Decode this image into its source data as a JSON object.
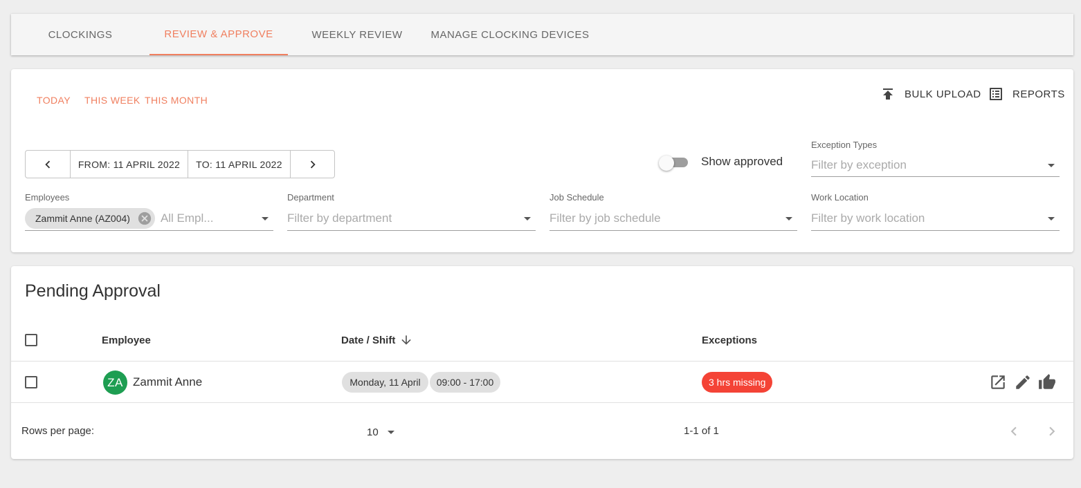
{
  "tabs": [
    {
      "label": "CLOCKINGS",
      "active": false
    },
    {
      "label": "REVIEW & APPROVE",
      "active": true
    },
    {
      "label": "WEEKLY REVIEW",
      "active": false
    },
    {
      "label": "MANAGE CLOCKING DEVICES",
      "active": false
    }
  ],
  "colors": {
    "accent": "#f07f5f",
    "avatar": "#1e9e52",
    "exception": "#f44336"
  },
  "quick_filters": {
    "today": "TODAY",
    "this_week": "THIS WEEK",
    "this_month": "THIS MONTH"
  },
  "actions": {
    "bulk_upload": {
      "label": "BULK UPLOAD",
      "icon": "upload-icon"
    },
    "reports": {
      "label": "REPORTS",
      "icon": "list-icon"
    }
  },
  "date_range": {
    "from": "FROM: 11 APRIL 2022",
    "to": "TO: 11 APRIL 2022"
  },
  "show_approved": {
    "label": "Show approved",
    "on": false
  },
  "filters": {
    "exception_types": {
      "label": "Exception Types",
      "placeholder": "Filter by exception"
    },
    "employees": {
      "label": "Employees",
      "chip": "Zammit Anne (AZ004)",
      "placeholder": "All Empl..."
    },
    "department": {
      "label": "Department",
      "placeholder": "Filter by department"
    },
    "job_schedule": {
      "label": "Job Schedule",
      "placeholder": "Filter by job schedule"
    },
    "work_location": {
      "label": "Work Location",
      "placeholder": "Filter by work location"
    }
  },
  "pending": {
    "title": "Pending Approval",
    "columns": {
      "employee": "Employee",
      "date_shift": "Date / Shift",
      "exceptions": "Exceptions"
    },
    "rows": [
      {
        "initials": "ZA",
        "name": "Zammit Anne",
        "date": "Monday, 11 April",
        "shift": "09:00 - 17:00",
        "exception": "3 hrs missing"
      }
    ],
    "footer": {
      "rows_per_page_label": "Rows per page:",
      "rows_per_page": "10",
      "range": "1-1 of 1"
    }
  }
}
